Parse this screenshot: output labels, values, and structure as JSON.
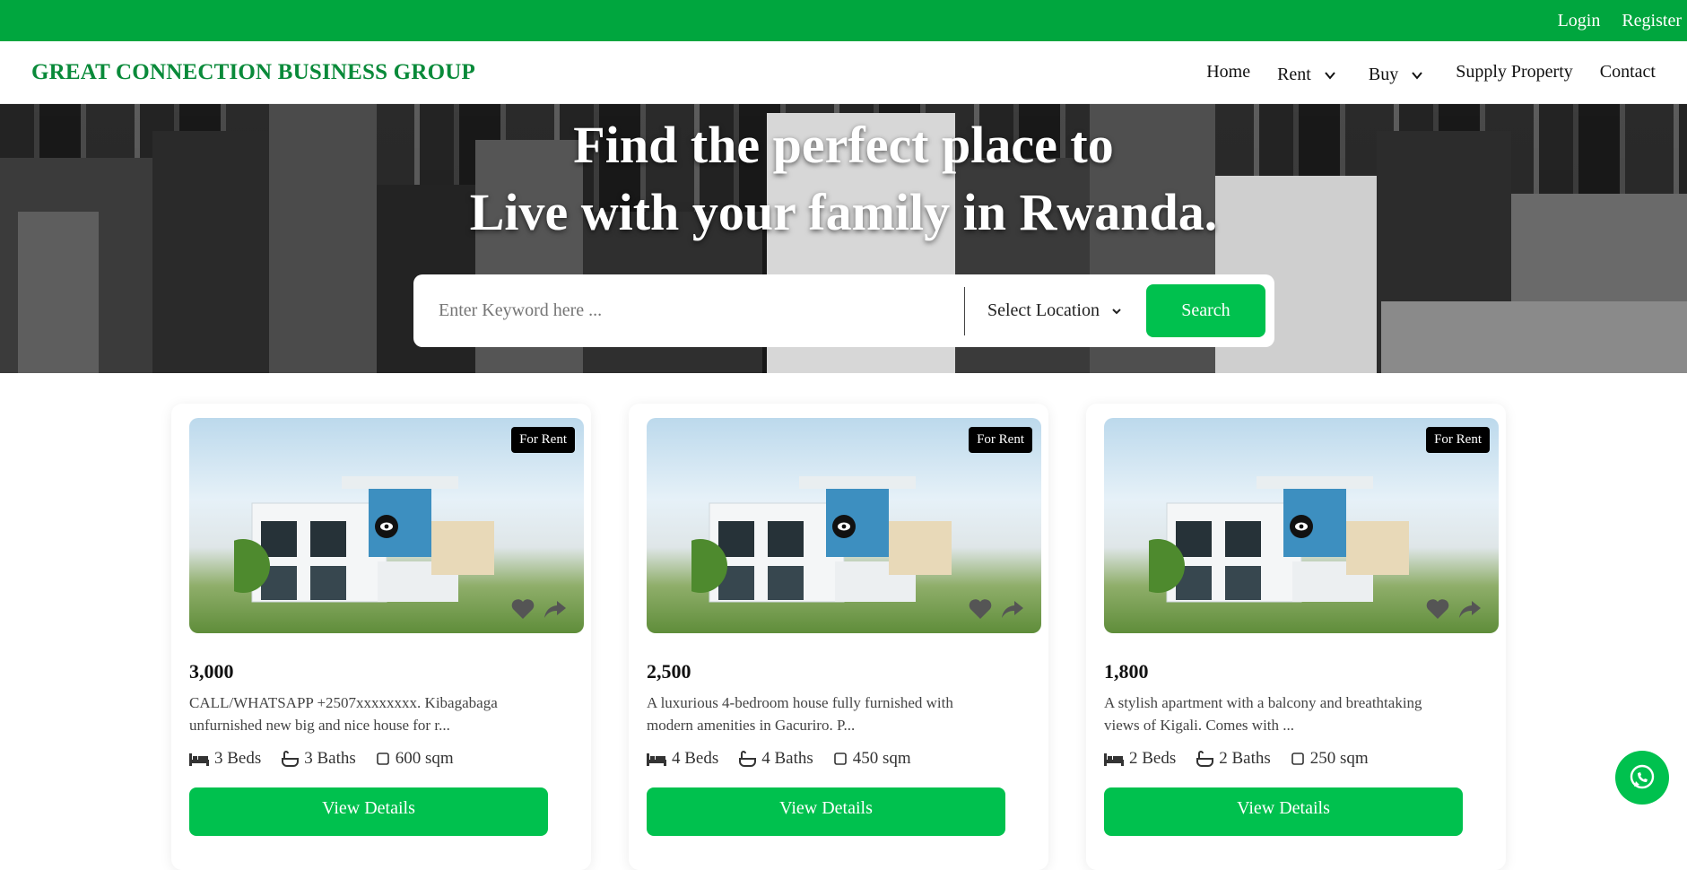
{
  "topbar": {
    "login": "Login",
    "register": "Register"
  },
  "brand": "GREAT CONNECTION BUSINESS GROUP",
  "nav": {
    "home": "Home",
    "rent": "Rent",
    "buy": "Buy",
    "supply": "Supply Property",
    "contact": "Contact"
  },
  "hero": {
    "line1": "Find the perfect place to",
    "line2": "Live with your family in Rwanda.",
    "search_placeholder": "Enter Keyword here ...",
    "location": "Select Location",
    "search_button": "Search"
  },
  "cards": [
    {
      "badge": "For Rent",
      "price": "3,000",
      "desc1": "CALL/WHATSAPP +2507xxxxxxxx. Kibagabaga",
      "desc2": "unfurnished new big and nice house for r...",
      "beds": "3 Beds",
      "baths": "3 Baths",
      "area": "600 sqm",
      "button": "View Details"
    },
    {
      "badge": "For Rent",
      "price": "2,500",
      "desc1": "A luxurious 4-bedroom house fully furnished with",
      "desc2": "modern amenities in Gacuriro. P...",
      "beds": "4 Beds",
      "baths": "4 Baths",
      "area": "450 sqm",
      "button": "View Details"
    },
    {
      "badge": "For Rent",
      "price": "1,800",
      "desc1": "A stylish apartment with a balcony and breathtaking",
      "desc2": "views of Kigali. Comes with ...",
      "beds": "2 Beds",
      "baths": "2 Baths",
      "area": "250 sqm",
      "button": "View Details"
    }
  ],
  "colors": {
    "brand_green": "#00a63e",
    "button_green": "#00c14e",
    "title_green": "#0a8a3a"
  }
}
